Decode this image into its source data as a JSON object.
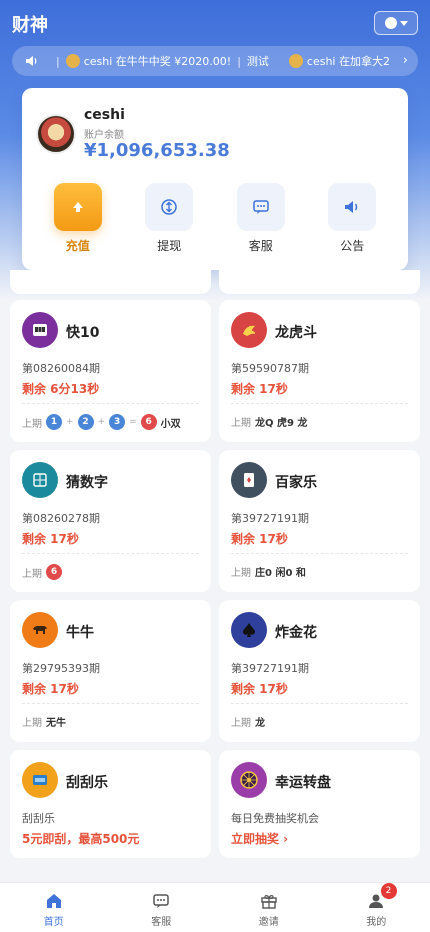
{
  "header": {
    "title": "财神"
  },
  "notice": {
    "items": [
      "ceshi 在牛牛中奖 ¥2020.00!",
      "测试",
      "ceshi 在加拿大2"
    ]
  },
  "user": {
    "name": "ceshi",
    "balance_label": "账户余额",
    "balance": "¥1,096,653.38"
  },
  "actions": [
    {
      "label": "充值",
      "icon": "upload-icon"
    },
    {
      "label": "提现",
      "icon": "exchange-icon"
    },
    {
      "label": "客服",
      "icon": "chat-icon"
    },
    {
      "label": "公告",
      "icon": "speaker-icon"
    }
  ],
  "games": [
    {
      "name": "快10",
      "period": "第08260084期",
      "remain": "剩余 6分13秒",
      "last_label": "上期",
      "balls": [
        "1",
        "2",
        "3"
      ],
      "sum": "6",
      "result": "小双",
      "icon": "slot-machine-icon",
      "color": "#7b2f9c"
    },
    {
      "name": "龙虎斗",
      "period": "第59590787期",
      "remain": "剩余 17秒",
      "last_label": "上期",
      "result": "龙Q 虎9 龙",
      "icon": "dragon-icon",
      "color": "#d84343"
    },
    {
      "name": "猜数字",
      "period": "第08260278期",
      "remain": "剩余 17秒",
      "last_label": "上期",
      "sum": "6",
      "icon": "number-grid-icon",
      "color": "#1b8a9c"
    },
    {
      "name": "百家乐",
      "period": "第39727191期",
      "remain": "剩余 17秒",
      "last_label": "上期",
      "result": "庄0 闲0 和",
      "icon": "cards-icon",
      "color": "#41505e"
    },
    {
      "name": "牛牛",
      "period": "第29795393期",
      "remain": "剩余 17秒",
      "last_label": "上期",
      "result": "无牛",
      "icon": "bull-icon",
      "color": "#f07c17"
    },
    {
      "name": "炸金花",
      "period": "第39727191期",
      "remain": "剩余 17秒",
      "last_label": "上期",
      "result": "龙",
      "icon": "spade-icon",
      "color": "#2f3f9c"
    },
    {
      "name": "刮刮乐",
      "desc": "刮刮乐",
      "promo": "5元即刮，最高500元",
      "icon": "ticket-icon",
      "color": "#f2a11a"
    },
    {
      "name": "幸运转盘",
      "desc": "每日免费抽奖机会",
      "promo": "立即抽奖 ›",
      "icon": "wheel-icon",
      "color": "#9b3da8"
    }
  ],
  "nav": [
    {
      "label": "首页",
      "icon": "home-icon",
      "active": true
    },
    {
      "label": "客服",
      "icon": "chat-icon"
    },
    {
      "label": "邀请",
      "icon": "gift-icon"
    },
    {
      "label": "我的",
      "icon": "user-icon",
      "badge": "2"
    }
  ],
  "colors": {
    "primary": "#3f73d9",
    "accent": "#f39a14",
    "danger": "#e5533b"
  }
}
